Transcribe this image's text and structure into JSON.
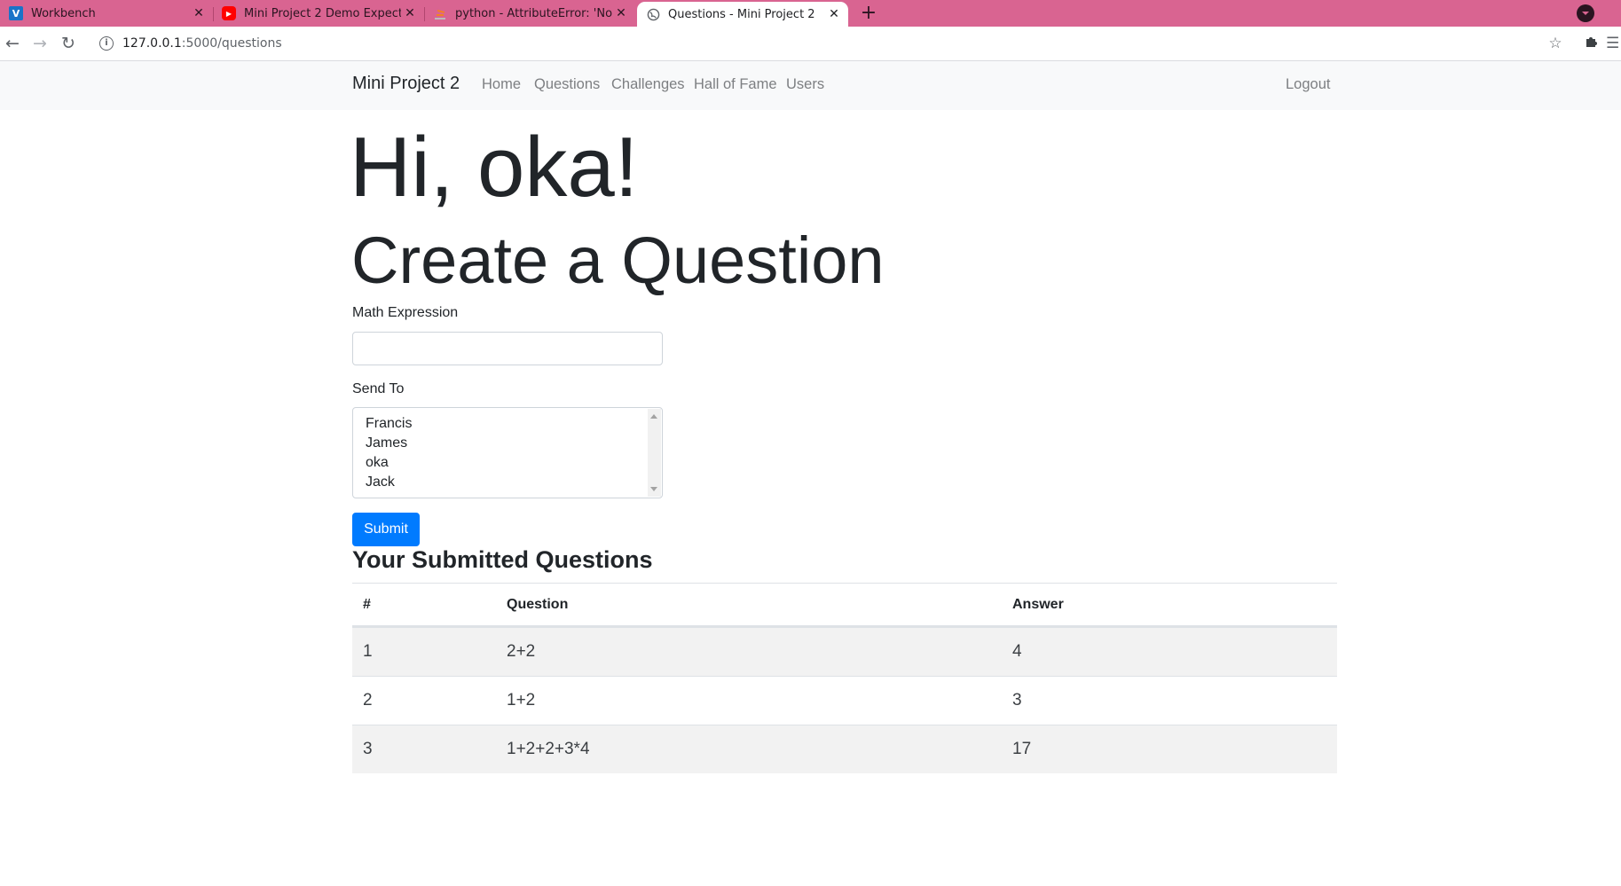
{
  "browser": {
    "tabs": [
      {
        "title": "Workbench",
        "favicon": "V",
        "favicon_color": "#1a73c8",
        "active": false
      },
      {
        "title": "Mini Project 2 Demo Expectations",
        "favicon": "youtube-icon",
        "favicon_color": "#ff0000",
        "active": false
      },
      {
        "title": "python - AttributeError: 'NoneType'",
        "favicon": "stackoverflow-icon",
        "favicon_color": "#f48024",
        "active": false
      },
      {
        "title": "Questions - Mini Project 2",
        "favicon": "globe-icon",
        "favicon_color": "#5f6368",
        "active": true
      }
    ],
    "url_host": "127.0.0.1",
    "url_path": ":5000/questions",
    "tabbar_color": "#d96491"
  },
  "navbar": {
    "brand": "Mini Project 2",
    "links": [
      "Home",
      "Questions",
      "Challenges",
      "Hall of Fame",
      "Users"
    ],
    "logout": "Logout"
  },
  "main": {
    "greeting": "Hi, oka!",
    "title": "Create a Question",
    "expression_label": "Math Expression",
    "expression_value": "",
    "send_to_label": "Send To",
    "send_to_options": [
      "Francis",
      "James",
      "oka",
      "Jack"
    ],
    "submit_label": "Submit",
    "submitted_heading": "Your Submitted Questions"
  },
  "table": {
    "columns": [
      "#",
      "Question",
      "Answer"
    ],
    "rows": [
      [
        "1",
        "2+2",
        "4"
      ],
      [
        "2",
        "1+2",
        "3"
      ],
      [
        "3",
        "1+2+2+3*4",
        "17"
      ]
    ]
  },
  "colors": {
    "primary": "#007bff",
    "navbar_bg": "#f8f9fa"
  }
}
